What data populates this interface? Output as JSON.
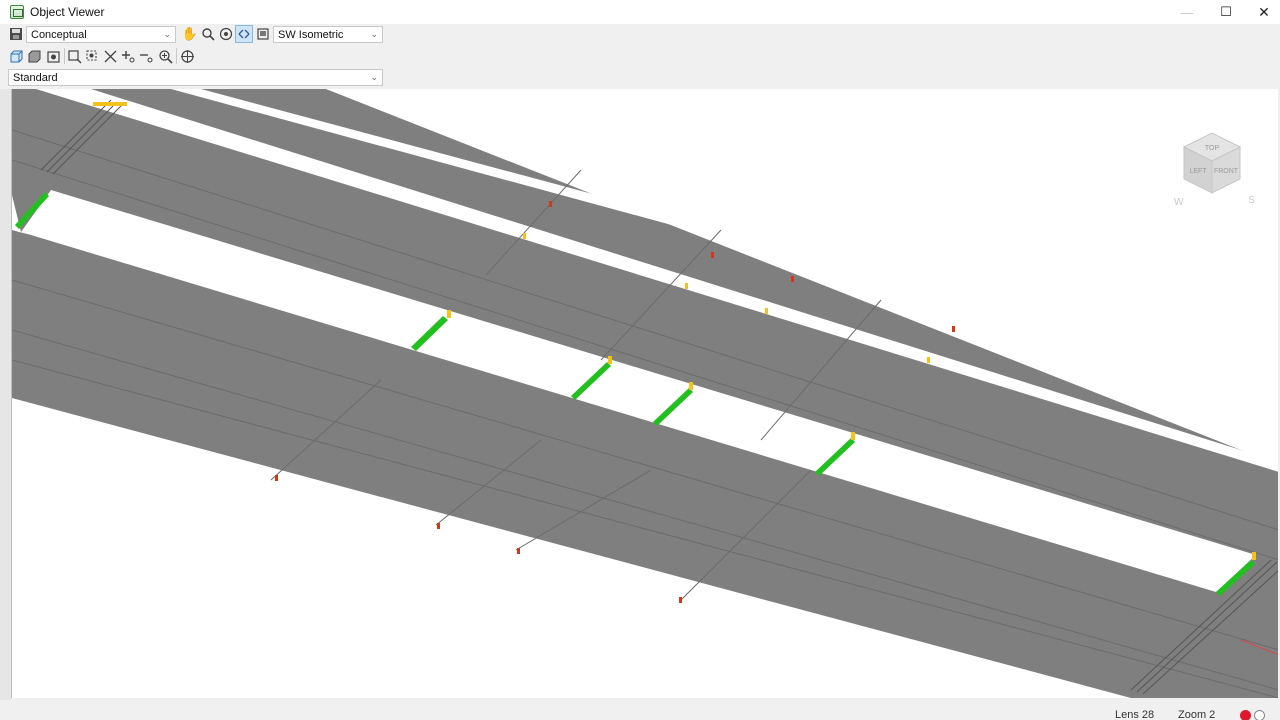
{
  "window": {
    "title": "Object Viewer",
    "min_icon": "minimize-icon",
    "max_icon": "maximize-icon",
    "close_icon": "close-icon"
  },
  "toolbar": {
    "visual_style": {
      "value": "Conceptual",
      "options_visible": [
        "Conceptual"
      ]
    },
    "view_preset": {
      "value": "SW Isometric"
    },
    "display_mode": {
      "value": "Standard"
    },
    "row1_icons": [
      "save-icon",
      "pan-icon",
      "zoom-icon",
      "orbit-icon",
      "free-orbit-icon",
      "view-preset-icon"
    ],
    "row2_icons": [
      "view-box-icon",
      "view-box-shaded-icon",
      "camera-icon",
      "zoom-window-icon",
      "zoom-object-icon",
      "zoom-extents-icon",
      "zoom-in-icon",
      "zoom-out-icon",
      "zoom-realtime-icon",
      "steering-wheel-icon"
    ]
  },
  "viewcube": {
    "faces": [
      "TOP",
      "LEFT",
      "FRONT"
    ],
    "compass": [
      "W",
      "S"
    ]
  },
  "status": {
    "lens": "Lens 28",
    "zoom": "Zoom 2"
  },
  "colors": {
    "road": "#7f7f7f",
    "road_line": "#6a6a6a",
    "green_accent": "#22c01e",
    "marker_yellow": "#f2c31a",
    "marker_red": "#d2391a",
    "record": "#e0182d"
  }
}
